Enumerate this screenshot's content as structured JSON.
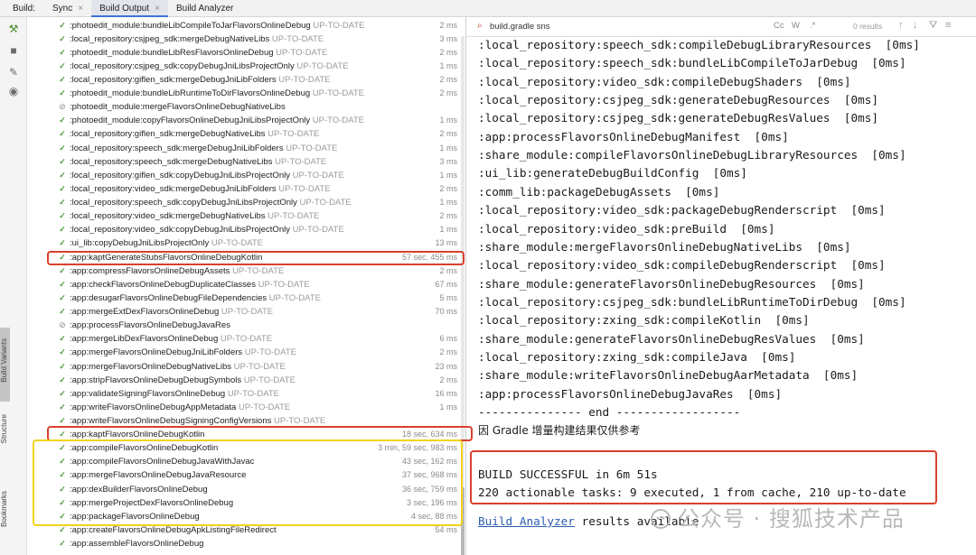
{
  "topbar": {
    "label": "Build:",
    "tabs": [
      {
        "label": "Sync",
        "closable": true,
        "active": false
      },
      {
        "label": "Build Output",
        "closable": true,
        "active": true
      },
      {
        "label": "Build Analyzer",
        "closable": false,
        "active": false
      }
    ]
  },
  "left_toolbar": {
    "icons": [
      "hammer-icon",
      "stop-icon",
      "pin-icon",
      "eye-icon"
    ],
    "side_labels": [
      "Build Variants",
      "Structure",
      "Bookmarks"
    ]
  },
  "tree": {
    "rows": [
      {
        "status": "ok",
        "task": ":photoedit_module:bundleLibCompileToJarFlavorsOnlineDebug",
        "suffix": "UP-TO-DATE",
        "time": "2 ms"
      },
      {
        "status": "ok",
        "task": ":local_repository:csjpeg_sdk:mergeDebugNativeLibs",
        "suffix": "UP-TO-DATE",
        "time": "3 ms"
      },
      {
        "status": "ok",
        "task": ":photoedit_module:bundleLibResFlavorsOnlineDebug",
        "suffix": "UP-TO-DATE",
        "time": "2 ms"
      },
      {
        "status": "ok",
        "task": ":local_repository:csjpeg_sdk:copyDebugJniLibsProjectOnly",
        "suffix": "UP-TO-DATE",
        "time": "1 ms"
      },
      {
        "status": "ok",
        "task": ":local_repository:giflen_sdk:mergeDebugJniLibFolders",
        "suffix": "UP-TO-DATE",
        "time": "2 ms"
      },
      {
        "status": "ok",
        "task": ":photoedit_module:bundleLibRuntimeToDirFlavorsOnlineDebug",
        "suffix": "UP-TO-DATE",
        "time": "2 ms"
      },
      {
        "status": "skip",
        "task": ":photoedit_module:mergeFlavorsOnlineDebugNativeLibs",
        "suffix": "",
        "time": ""
      },
      {
        "status": "ok",
        "task": ":photoedit_module:copyFlavorsOnlineDebugJniLibsProjectOnly",
        "suffix": "UP-TO-DATE",
        "time": "1 ms"
      },
      {
        "status": "ok",
        "task": ":local_repository:giflen_sdk:mergeDebugNativeLibs",
        "suffix": "UP-TO-DATE",
        "time": "2 ms"
      },
      {
        "status": "ok",
        "task": ":local_repository:speech_sdk:mergeDebugJniLibFolders",
        "suffix": "UP-TO-DATE",
        "time": "1 ms"
      },
      {
        "status": "ok",
        "task": ":local_repository:speech_sdk:mergeDebugNativeLibs",
        "suffix": "UP-TO-DATE",
        "time": "3 ms"
      },
      {
        "status": "ok",
        "task": ":local_repository:giflen_sdk:copyDebugJniLibsProjectOnly",
        "suffix": "UP-TO-DATE",
        "time": "1 ms"
      },
      {
        "status": "ok",
        "task": ":local_repository:video_sdk:mergeDebugJniLibFolders",
        "suffix": "UP-TO-DATE",
        "time": "2 ms"
      },
      {
        "status": "ok",
        "task": ":local_repository:speech_sdk:copyDebugJniLibsProjectOnly",
        "suffix": "UP-TO-DATE",
        "time": "1 ms"
      },
      {
        "status": "ok",
        "task": ":local_repository:video_sdk:mergeDebugNativeLibs",
        "suffix": "UP-TO-DATE",
        "time": "2 ms"
      },
      {
        "status": "ok",
        "task": ":local_repository:video_sdk:copyDebugJniLibsProjectOnly",
        "suffix": "UP-TO-DATE",
        "time": "1 ms"
      },
      {
        "status": "ok",
        "task": ":ui_lib:copyDebugJniLibsProjectOnly",
        "suffix": "UP-TO-DATE",
        "time": "13 ms"
      },
      {
        "status": "ok",
        "task": ":app:kaptGenerateStubsFlavorsOnlineDebugKotlin",
        "suffix": "",
        "time": "57 sec, 455 ms"
      },
      {
        "status": "ok",
        "task": ":app:compressFlavorsOnlineDebugAssets",
        "suffix": "UP-TO-DATE",
        "time": "2 ms"
      },
      {
        "status": "ok",
        "task": ":app:checkFlavorsOnlineDebugDuplicateClasses",
        "suffix": "UP-TO-DATE",
        "time": "67 ms"
      },
      {
        "status": "ok",
        "task": ":app:desugarFlavorsOnlineDebugFileDependencies",
        "suffix": "UP-TO-DATE",
        "time": "5 ms"
      },
      {
        "status": "ok",
        "task": ":app:mergeExtDexFlavorsOnlineDebug",
        "suffix": "UP-TO-DATE",
        "time": "70 ms"
      },
      {
        "status": "skip",
        "task": ":app:processFlavorsOnlineDebugJavaRes",
        "suffix": "",
        "time": ""
      },
      {
        "status": "ok",
        "task": ":app:mergeLibDexFlavorsOnlineDebug",
        "suffix": "UP-TO-DATE",
        "time": "6 ms"
      },
      {
        "status": "ok",
        "task": ":app:mergeFlavorsOnlineDebugJniLibFolders",
        "suffix": "UP-TO-DATE",
        "time": "2 ms"
      },
      {
        "status": "ok",
        "task": ":app:mergeFlavorsOnlineDebugNativeLibs",
        "suffix": "UP-TO-DATE",
        "time": "23 ms"
      },
      {
        "status": "ok",
        "task": ":app:stripFlavorsOnlineDebugDebugSymbols",
        "suffix": "UP-TO-DATE",
        "time": "2 ms"
      },
      {
        "status": "ok",
        "task": ":app:validateSigningFlavorsOnlineDebug",
        "suffix": "UP-TO-DATE",
        "time": "16 ms"
      },
      {
        "status": "ok",
        "task": ":app:writeFlavorsOnlineDebugAppMetadata",
        "suffix": "UP-TO-DATE",
        "time": "1 ms"
      },
      {
        "status": "ok",
        "task": ":app:writeFlavorsOnlineDebugSigningConfigVersions",
        "suffix": "UP-TO-DATE",
        "time": ""
      },
      {
        "status": "ok",
        "task": ":app:kaptFlavorsOnlineDebugKotlin",
        "suffix": "",
        "time": "18 sec, 634 ms"
      },
      {
        "status": "ok",
        "task": ":app:compileFlavorsOnlineDebugKotlin",
        "suffix": "",
        "time": "3 min, 59 sec, 983 ms"
      },
      {
        "status": "ok",
        "task": ":app:compileFlavorsOnlineDebugJavaWithJavac",
        "suffix": "",
        "time": "43 sec, 162 ms"
      },
      {
        "status": "ok",
        "task": ":app:mergeFlavorsOnlineDebugJavaResource",
        "suffix": "",
        "time": "37 sec, 968 ms"
      },
      {
        "status": "ok",
        "task": ":app:dexBuilderFlavorsOnlineDebug",
        "suffix": "",
        "time": "36 sec, 759 ms"
      },
      {
        "status": "ok",
        "task": ":app:mergeProjectDexFlavorsOnlineDebug",
        "suffix": "",
        "time": "3 sec, 196 ms"
      },
      {
        "status": "ok",
        "task": ":app:packageFlavorsOnlineDebug",
        "suffix": "",
        "time": "4 sec, 88 ms"
      },
      {
        "status": "ok",
        "task": ":app:createFlavorsOnlineDebugApkListingFileRedirect",
        "suffix": "",
        "time": "54 ms"
      },
      {
        "status": "ok",
        "task": ":app:assembleFlavorsOnlineDebug",
        "suffix": "",
        "time": ""
      }
    ]
  },
  "search": {
    "query": "build.gradle sns",
    "options": [
      "Cc",
      "W",
      ".*"
    ],
    "results": "0 results"
  },
  "console": {
    "lines": [
      ":local_repository:speech_sdk:compileDebugLibraryResources  [0ms]",
      ":local_repository:speech_sdk:bundleLibCompileToJarDebug  [0ms]",
      ":local_repository:video_sdk:compileDebugShaders  [0ms]",
      ":local_repository:csjpeg_sdk:generateDebugResources  [0ms]",
      ":local_repository:csjpeg_sdk:generateDebugResValues  [0ms]",
      ":app:processFlavorsOnlineDebugManifest  [0ms]",
      ":share_module:compileFlavorsOnlineDebugLibraryResources  [0ms]",
      ":ui_lib:generateDebugBuildConfig  [0ms]",
      ":comm_lib:packageDebugAssets  [0ms]",
      ":local_repository:video_sdk:packageDebugRenderscript  [0ms]",
      ":local_repository:video_sdk:preBuild  [0ms]",
      ":share_module:mergeFlavorsOnlineDebugNativeLibs  [0ms]",
      ":local_repository:video_sdk:compileDebugRenderscript  [0ms]",
      ":share_module:generateFlavorsOnlineDebugResources  [0ms]",
      ":local_repository:csjpeg_sdk:bundleLibRuntimeToDirDebug  [0ms]",
      ":local_repository:zxing_sdk:compileKotlin  [0ms]",
      ":share_module:generateFlavorsOnlineDebugResValues  [0ms]",
      ":local_repository:zxing_sdk:compileJava  [0ms]",
      ":share_module:writeFlavorsOnlineDebugAarMetadata  [0ms]",
      ":app:processFlavorsOnlineDebugJavaRes  [0ms]",
      "--------------- end ------------------",
      "因 Gradle 增量构建结果仅供参考",
      "",
      "BUILD SUCCESSFUL in 6m 51s",
      "220 actionable tasks: 9 executed, 1 from cache, 210 up-to-date"
    ],
    "analyzer_link": "Build Analyzer",
    "analyzer_rest": " results available"
  },
  "watermark": "公众号 · 搜狐技术产品"
}
